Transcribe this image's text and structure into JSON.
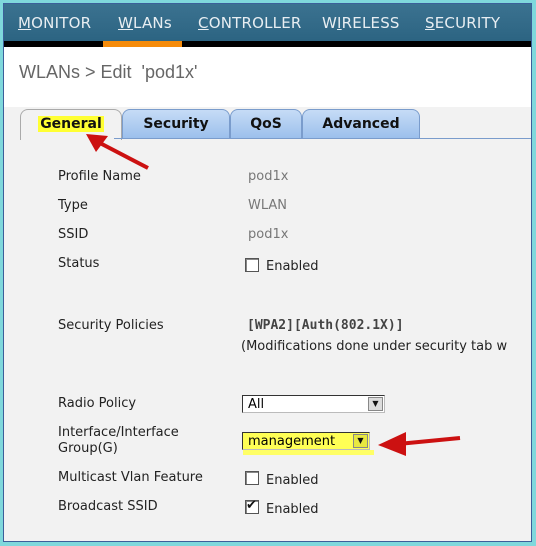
{
  "nav": {
    "items": [
      {
        "label_pre": "",
        "label_u": "M",
        "label_post": "ONITOR"
      },
      {
        "label_pre": "",
        "label_u": "W",
        "label_post": "LANs"
      },
      {
        "label_pre": "",
        "label_u": "C",
        "label_post": "ONTROLLER"
      },
      {
        "label_pre": "W",
        "label_u": "I",
        "label_post": "RELESS"
      },
      {
        "label_pre": "",
        "label_u": "S",
        "label_post": "ECURITY"
      }
    ],
    "active_index": 1,
    "active_color": "#f58b0a"
  },
  "page": {
    "title": "WLANs > Edit  'pod1x'"
  },
  "tabs": [
    {
      "label": "General",
      "active": true
    },
    {
      "label": "Security",
      "active": false
    },
    {
      "label": "QoS",
      "active": false
    },
    {
      "label": "Advanced",
      "active": false
    }
  ],
  "form": {
    "profile_name": {
      "label": "Profile Name",
      "value": "pod1x"
    },
    "type": {
      "label": "Type",
      "value": "WLAN"
    },
    "ssid": {
      "label": "SSID",
      "value": "pod1x"
    },
    "status": {
      "label": "Status",
      "checkbox_label": "Enabled",
      "checked": false
    },
    "security_policies": {
      "label": "Security Policies",
      "value": "[WPA2][Auth(802.1X)]",
      "note": "(Modifications done under security tab w"
    },
    "radio_policy": {
      "label": "Radio Policy",
      "selected": "All"
    },
    "interface": {
      "label_line1": "Interface/Interface",
      "label_line2": "Group(G)",
      "selected": "management"
    },
    "multicast_vlan": {
      "label": "Multicast Vlan Feature",
      "checkbox_label": "Enabled",
      "checked": false
    },
    "broadcast_ssid": {
      "label": "Broadcast SSID",
      "checkbox_label": "Enabled",
      "checked": true
    }
  },
  "annotations": {
    "highlight_color": "#ffff33",
    "arrow_color": "#cc1111"
  }
}
